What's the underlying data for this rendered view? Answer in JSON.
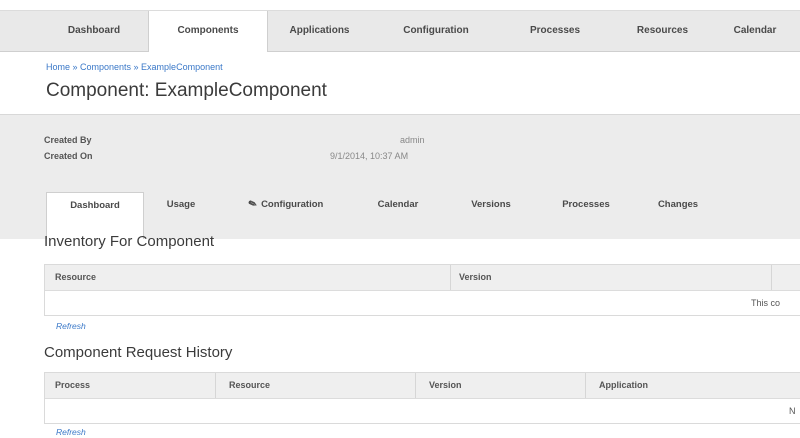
{
  "topnav": {
    "tabs": [
      "Dashboard",
      "Components",
      "Applications",
      "Configuration",
      "Processes",
      "Resources",
      "Calendar"
    ]
  },
  "breadcrumb": "Home » Components » ExampleComponent",
  "page_title": "Component: ExampleComponent",
  "info": {
    "created_by_label": "Created By",
    "created_by_value": "admin",
    "created_on_label": "Created On",
    "created_on_value": "9/1/2014, 10:37 AM"
  },
  "subtabs": [
    "Dashboard",
    "Usage",
    "Configuration",
    "Calendar",
    "Versions",
    "Processes",
    "Changes"
  ],
  "inventory": {
    "title": "Inventory For Component",
    "columns": [
      "Resource",
      "Version"
    ],
    "empty_text": "This co",
    "refresh": "Refresh"
  },
  "history": {
    "title": "Component Request History",
    "columns": [
      "Process",
      "Resource",
      "Version",
      "Application"
    ],
    "empty_text": "N",
    "refresh": "Refresh"
  }
}
